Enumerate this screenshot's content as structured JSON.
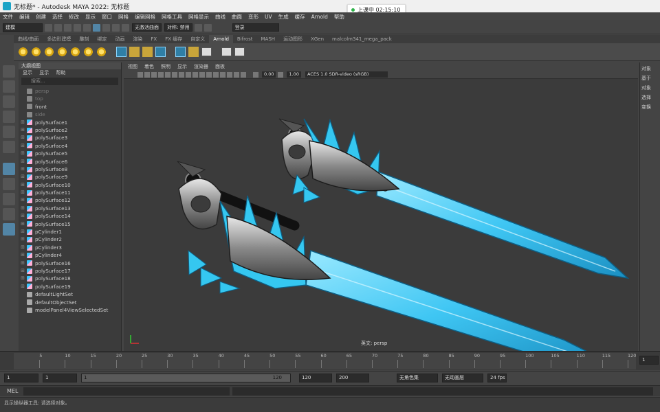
{
  "title": "无标题* - Autodesk MAYA 2022: 无标题",
  "clock": "上课中 02:15:10",
  "menu": [
    "文件",
    "编辑",
    "创建",
    "选择",
    "修改",
    "显示",
    "窗口",
    "网格",
    "编辑网格",
    "网格工具",
    "网格显示",
    "曲线",
    "曲面",
    "变形",
    "UV",
    "生成",
    "缓存",
    "Arnold",
    "帮助"
  ],
  "status": {
    "workspace": "建模",
    "live_surface": "无激活曲面",
    "symmetry": "对称: 禁用",
    "login": "登录"
  },
  "shelf_tabs": [
    "曲线/曲面",
    "多边形建模",
    "雕刻",
    "绑定",
    "动画",
    "渲染",
    "FX",
    "FX 缓存",
    "自定义",
    "Arnold",
    "Bifrost",
    "MASH",
    "运动图形",
    "XGen",
    "malcolm341_mega_pack"
  ],
  "shelf_active": "Arnold",
  "outliner": {
    "header": "大纲视图",
    "menus": [
      "显示",
      "显示",
      "帮助"
    ],
    "search": "搜索...",
    "items": [
      {
        "name": "persp",
        "type": "cam",
        "dim": true
      },
      {
        "name": "top",
        "type": "cam",
        "dim": true
      },
      {
        "name": "front",
        "type": "cam",
        "dim": false
      },
      {
        "name": "side",
        "type": "cam",
        "dim": true
      },
      {
        "name": "polySurface1",
        "type": "mesh"
      },
      {
        "name": "polySurface2",
        "type": "mesh"
      },
      {
        "name": "polySurface3",
        "type": "mesh"
      },
      {
        "name": "polySurface4",
        "type": "mesh"
      },
      {
        "name": "polySurface5",
        "type": "mesh"
      },
      {
        "name": "polySurface6",
        "type": "mesh"
      },
      {
        "name": "polySurface8",
        "type": "mesh"
      },
      {
        "name": "polySurface9",
        "type": "mesh"
      },
      {
        "name": "polySurface10",
        "type": "mesh"
      },
      {
        "name": "polySurface11",
        "type": "mesh"
      },
      {
        "name": "polySurface12",
        "type": "mesh"
      },
      {
        "name": "polySurface13",
        "type": "mesh"
      },
      {
        "name": "polySurface14",
        "type": "mesh"
      },
      {
        "name": "polySurface15",
        "type": "mesh"
      },
      {
        "name": "pCylinder1",
        "type": "mesh"
      },
      {
        "name": "pCylinder2",
        "type": "mesh"
      },
      {
        "name": "pCylinder3",
        "type": "mesh"
      },
      {
        "name": "pCylinder4",
        "type": "mesh"
      },
      {
        "name": "polySurface16",
        "type": "mesh"
      },
      {
        "name": "polySurface17",
        "type": "mesh"
      },
      {
        "name": "polySurface18",
        "type": "mesh"
      },
      {
        "name": "polySurface19",
        "type": "mesh"
      },
      {
        "name": "defaultLightSet",
        "type": "set"
      },
      {
        "name": "defaultObjectSet",
        "type": "set"
      },
      {
        "name": "modelPanel4ViewSelectedSet",
        "type": "set"
      }
    ]
  },
  "viewport": {
    "menus": [
      "视图",
      "着色",
      "照明",
      "显示",
      "渲染器",
      "面板"
    ],
    "exposure": "0.00",
    "gamma": "1.00",
    "colorspace": "ACES 1.0 SDR-video (sRGB)",
    "camera_label": "英文: persp"
  },
  "right_panel": [
    "对象",
    "基于",
    "对象",
    "选择",
    "变换"
  ],
  "timeline": {
    "ticks": [
      5,
      10,
      15,
      20,
      25,
      30,
      35,
      40,
      45,
      50,
      55,
      60,
      65,
      70,
      75,
      80,
      85,
      90,
      95,
      100,
      105,
      110,
      115,
      120
    ],
    "current": "1"
  },
  "range": {
    "start": "1",
    "start2": "1",
    "inner_start": "1",
    "inner_end": "120",
    "end": "120",
    "end2": "200",
    "anim_layer": "无角色集",
    "no_anim": "无动画层",
    "fps": "24 fps"
  },
  "cmd": "MEL",
  "help": "显示操纵器工具: 请选择对象。"
}
